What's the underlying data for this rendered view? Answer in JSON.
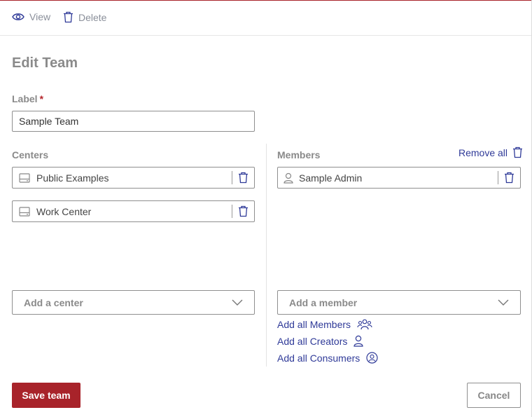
{
  "toolbar": {
    "view_label": "View",
    "delete_label": "Delete"
  },
  "form": {
    "title": "Edit Team",
    "label_field": {
      "label": "Label",
      "required_marker": "*",
      "value": "Sample Team"
    },
    "centers": {
      "label": "Centers",
      "items": [
        {
          "label": "Public Examples"
        },
        {
          "label": "Work Center"
        }
      ],
      "add_placeholder": "Add a center"
    },
    "members": {
      "label": "Members",
      "remove_all_label": "Remove all",
      "items": [
        {
          "label": "Sample Admin"
        }
      ],
      "add_placeholder": "Add a member",
      "add_links": {
        "all_members": "Add all Members",
        "all_creators": "Add all Creators",
        "all_consumers": "Add all Consumers"
      }
    },
    "actions": {
      "save_label": "Save team",
      "cancel_label": "Cancel"
    }
  },
  "colors": {
    "brand": "#a8232a",
    "link": "#2f3a98",
    "muted": "#8a8a8a"
  }
}
